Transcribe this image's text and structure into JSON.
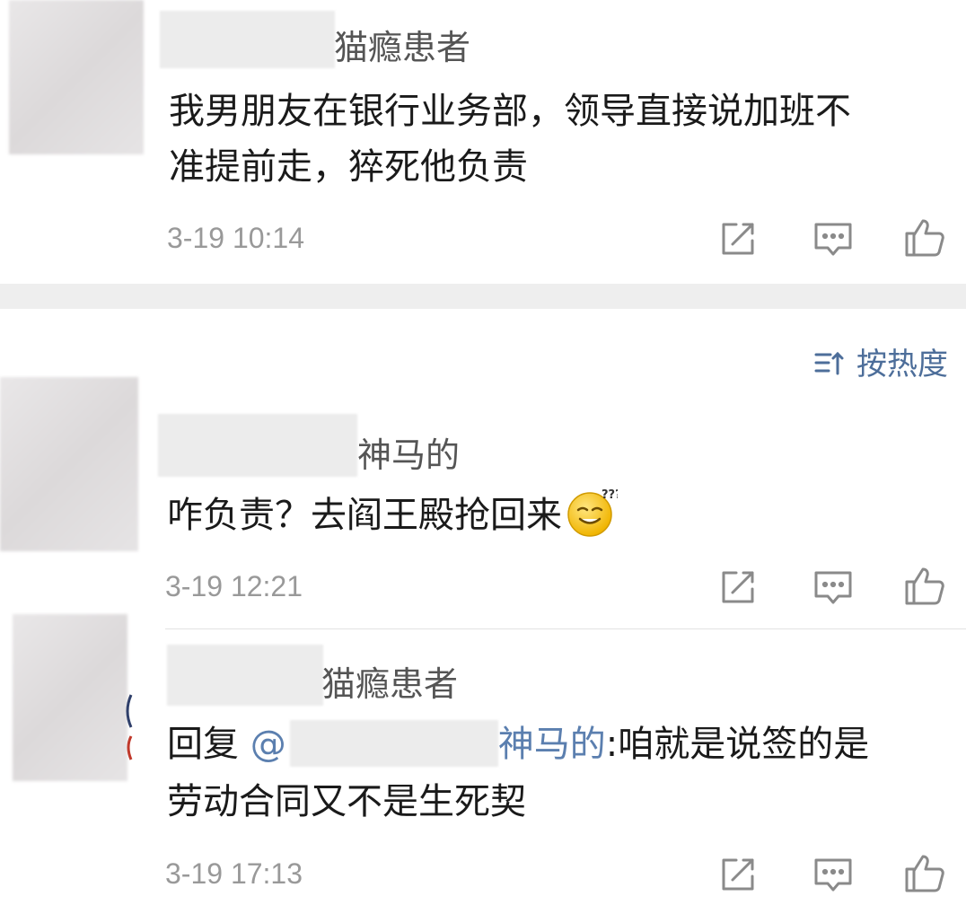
{
  "comments": [
    {
      "name": "猫瘾患者",
      "lines": [
        "我男朋友在银行业务部，领导直接说加班不",
        "准提前走，猝死他负责"
      ],
      "time": "3-19 10:14"
    },
    {
      "name": "神马的",
      "text": "咋负责？去阎王殿抢回来",
      "emoji": "sweat-smile-emoji",
      "time": "3-19 12:21"
    },
    {
      "name": "猫瘾患者",
      "reply_prefix": "回复 ",
      "mention_at": "@",
      "mention_name": "神马的",
      "reply_text": ":咱就是说签的是",
      "line2": "劳动合同又不是生死契",
      "time": "3-19 17:13"
    }
  ],
  "sort": {
    "label": "按热度",
    "icon": "sort-icon"
  },
  "actions": {
    "share_icon": "share-icon",
    "comment_icon": "comment-icon",
    "like_icon": "thumbs-up-icon"
  },
  "colors": {
    "link": "#5b7faf",
    "sort": "#4d6e9a",
    "meta": "#999999",
    "icon": "#8a8a8a"
  }
}
